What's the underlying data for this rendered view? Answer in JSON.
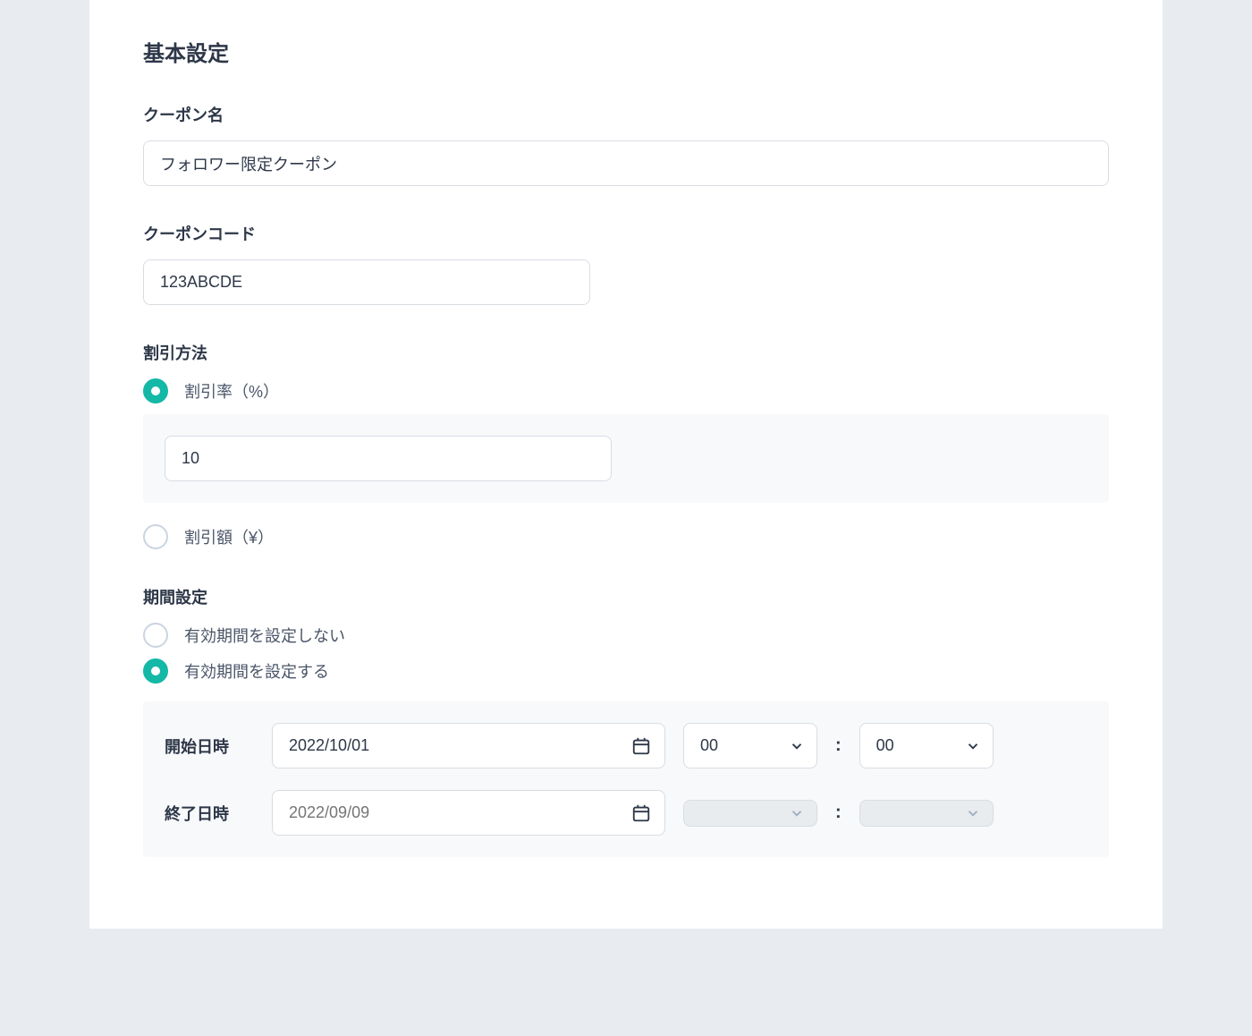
{
  "section_title": "基本設定",
  "coupon_name": {
    "label": "クーポン名",
    "value": "フォロワー限定クーポン"
  },
  "coupon_code": {
    "label": "クーポンコード",
    "value": "123ABCDE"
  },
  "discount_method": {
    "label": "割引方法",
    "options": {
      "percent": "割引率（%）",
      "amount": "割引額（¥）"
    },
    "selected": "percent",
    "percent_value": "10"
  },
  "period": {
    "label": "期間設定",
    "options": {
      "no_period": "有効期間を設定しない",
      "set_period": "有効期間を設定する"
    },
    "selected": "set_period",
    "start": {
      "label": "開始日時",
      "date": "2022/10/01",
      "hour": "00",
      "minute": "00"
    },
    "end": {
      "label": "終了日時",
      "date_placeholder": "2022/09/09",
      "hour": "",
      "minute": ""
    },
    "colon": ":"
  }
}
